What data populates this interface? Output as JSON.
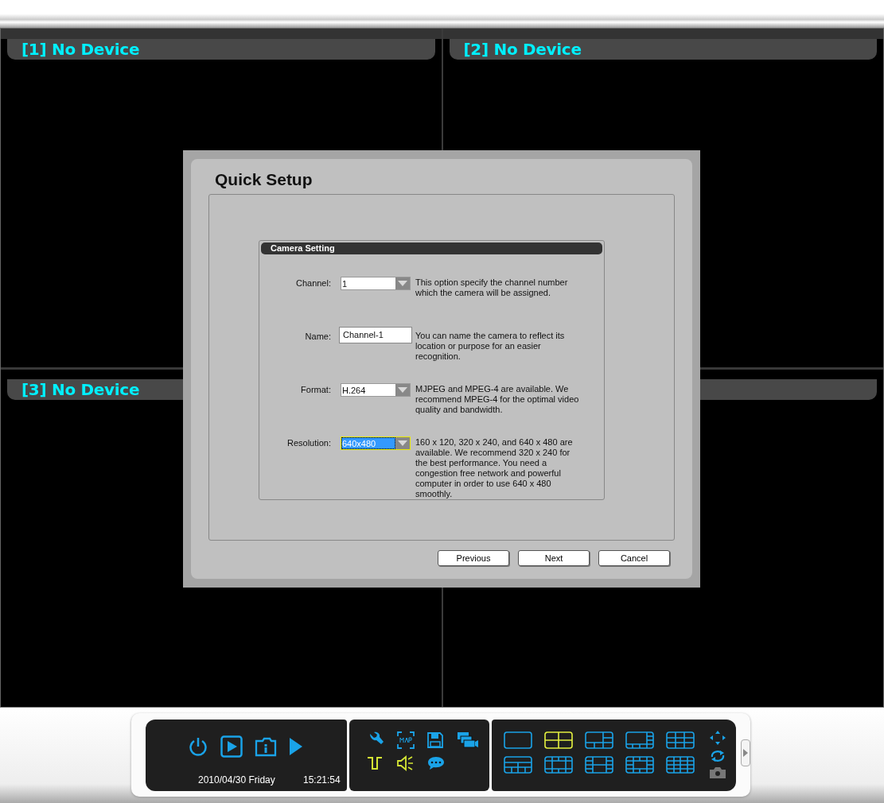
{
  "cells": [
    {
      "label": "[1] No Device"
    },
    {
      "label": "[2] No Device"
    },
    {
      "label": "[3] No Device"
    },
    {}
  ],
  "dialog": {
    "title": "Quick Setup",
    "section": "Camera Setting",
    "fields": [
      {
        "kind": "dropdown",
        "label": "Channel:",
        "value": "1",
        "selected": false,
        "description": "This option specify the channel number which the camera will be assigned."
      },
      {
        "kind": "text",
        "label": "Name:",
        "value": "Channel-1",
        "selected": false,
        "description": "You can name the camera to reflect its location or purpose for an easier recognition."
      },
      {
        "kind": "dropdown",
        "label": "Format:",
        "value": "H.264",
        "selected": false,
        "description": "MJPEG and MPEG-4 are available. We recommend MPEG-4 for the optimal video quality and bandwidth."
      },
      {
        "kind": "dropdown",
        "label": "Resolution:",
        "value": "640x480",
        "selected": true,
        "description": "160 x 120, 320 x 240, and 640 x 480 are available. We recommend 320 x 240 for the best performance. You need a congestion free network and powerful computer in order to use 640 x 480 smoothly."
      }
    ],
    "buttons": [
      "Previous",
      "Next",
      "Cancel"
    ]
  },
  "toolbar": {
    "controls": [
      {
        "kind": "power"
      },
      {
        "kind": "playback"
      },
      {
        "kind": "info"
      },
      {
        "kind": "play"
      }
    ],
    "date": "2010/04/30 Friday",
    "time": "15:21:54",
    "tools": [
      {
        "kind": "wrench",
        "color": "#1aa3e8"
      },
      {
        "kind": "map",
        "color": "#1aa3e8"
      },
      {
        "kind": "save",
        "color": "#1aa3e8"
      },
      {
        "kind": "cameras",
        "color": "#1aa3e8"
      },
      {
        "kind": "signal",
        "color": "#d4e634"
      },
      {
        "kind": "speaker",
        "color": "#d4e634"
      },
      {
        "kind": "chat",
        "color": "#1aa3e8"
      }
    ],
    "layouts": [
      {
        "kind": "single",
        "selected": false
      },
      {
        "kind": "quad",
        "selected": true
      },
      {
        "kind": "six",
        "selected": false
      },
      {
        "kind": "eight",
        "selected": false
      },
      {
        "kind": "nine",
        "selected": false
      },
      {
        "kind": "ten",
        "selected": false
      },
      {
        "kind": "thirteen",
        "selected": false
      },
      {
        "kind": "thirteen-b",
        "selected": false
      },
      {
        "kind": "sixteen-b",
        "selected": false
      },
      {
        "kind": "sixteen",
        "selected": false
      }
    ]
  }
}
